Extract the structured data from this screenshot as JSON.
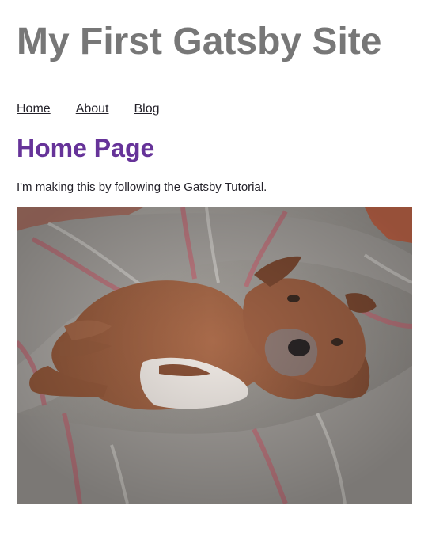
{
  "site": {
    "title": "My First Gatsby Site"
  },
  "nav": {
    "items": [
      {
        "label": "Home"
      },
      {
        "label": "About"
      },
      {
        "label": "Blog"
      }
    ]
  },
  "page": {
    "heading": "Home Page",
    "intro": "I'm making this by following the Gatsby Tutorial."
  },
  "image": {
    "subject": "dog lying on a striped blanket bed"
  },
  "colors": {
    "title": "#777777",
    "heading": "#663399",
    "text": "#232129"
  }
}
